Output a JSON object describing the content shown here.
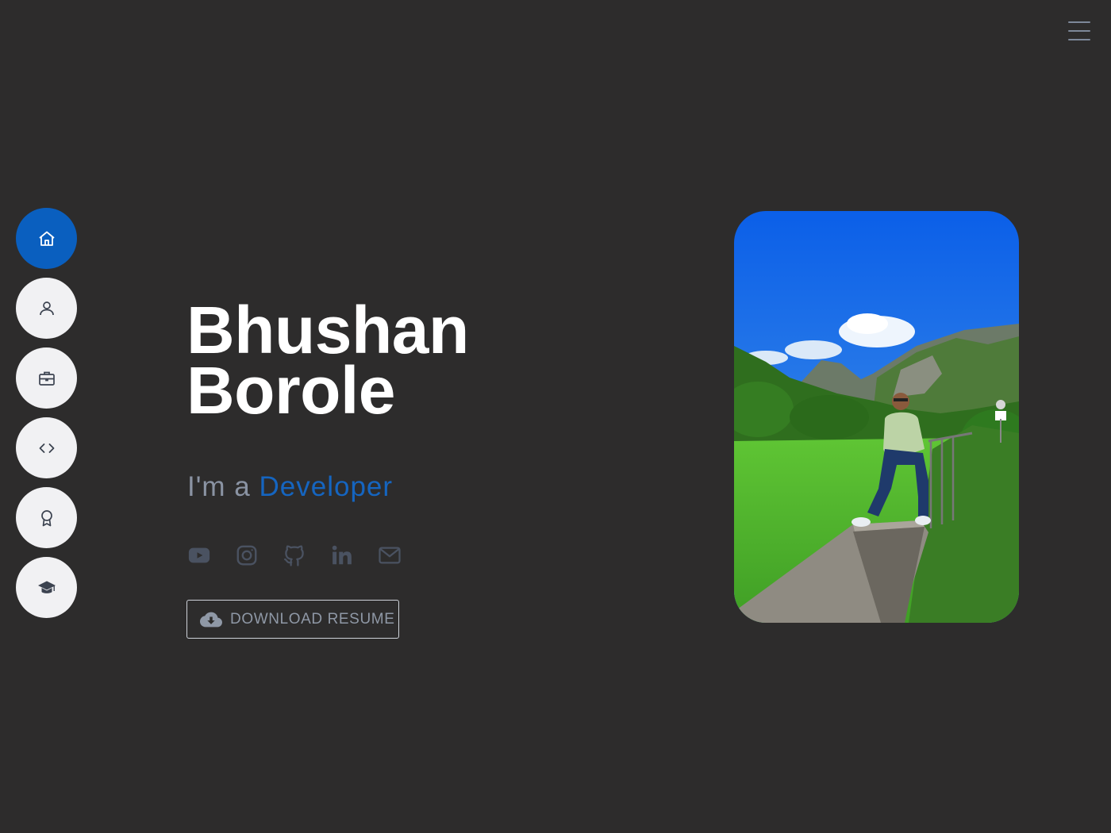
{
  "hero": {
    "first_name": "Bhushan",
    "last_name": "Borole",
    "tagline_prefix": "I'm a",
    "tagline_role": "Developer",
    "resume_label": "DOWNLOAD RESUME"
  },
  "nav": {
    "items": [
      {
        "icon": "home-icon",
        "active": true
      },
      {
        "icon": "user-icon",
        "active": false
      },
      {
        "icon": "briefcase-icon",
        "active": false
      },
      {
        "icon": "code-icon",
        "active": false
      },
      {
        "icon": "award-icon",
        "active": false
      },
      {
        "icon": "graduation-cap-icon",
        "active": false
      }
    ]
  },
  "socials": [
    "youtube-icon",
    "instagram-icon",
    "github-icon",
    "linkedin-icon",
    "email-icon"
  ],
  "colors": {
    "background": "#2d2c2c",
    "accent": "#0a5fbf",
    "role_text": "#1565c0",
    "muted": "#8a93a3"
  }
}
